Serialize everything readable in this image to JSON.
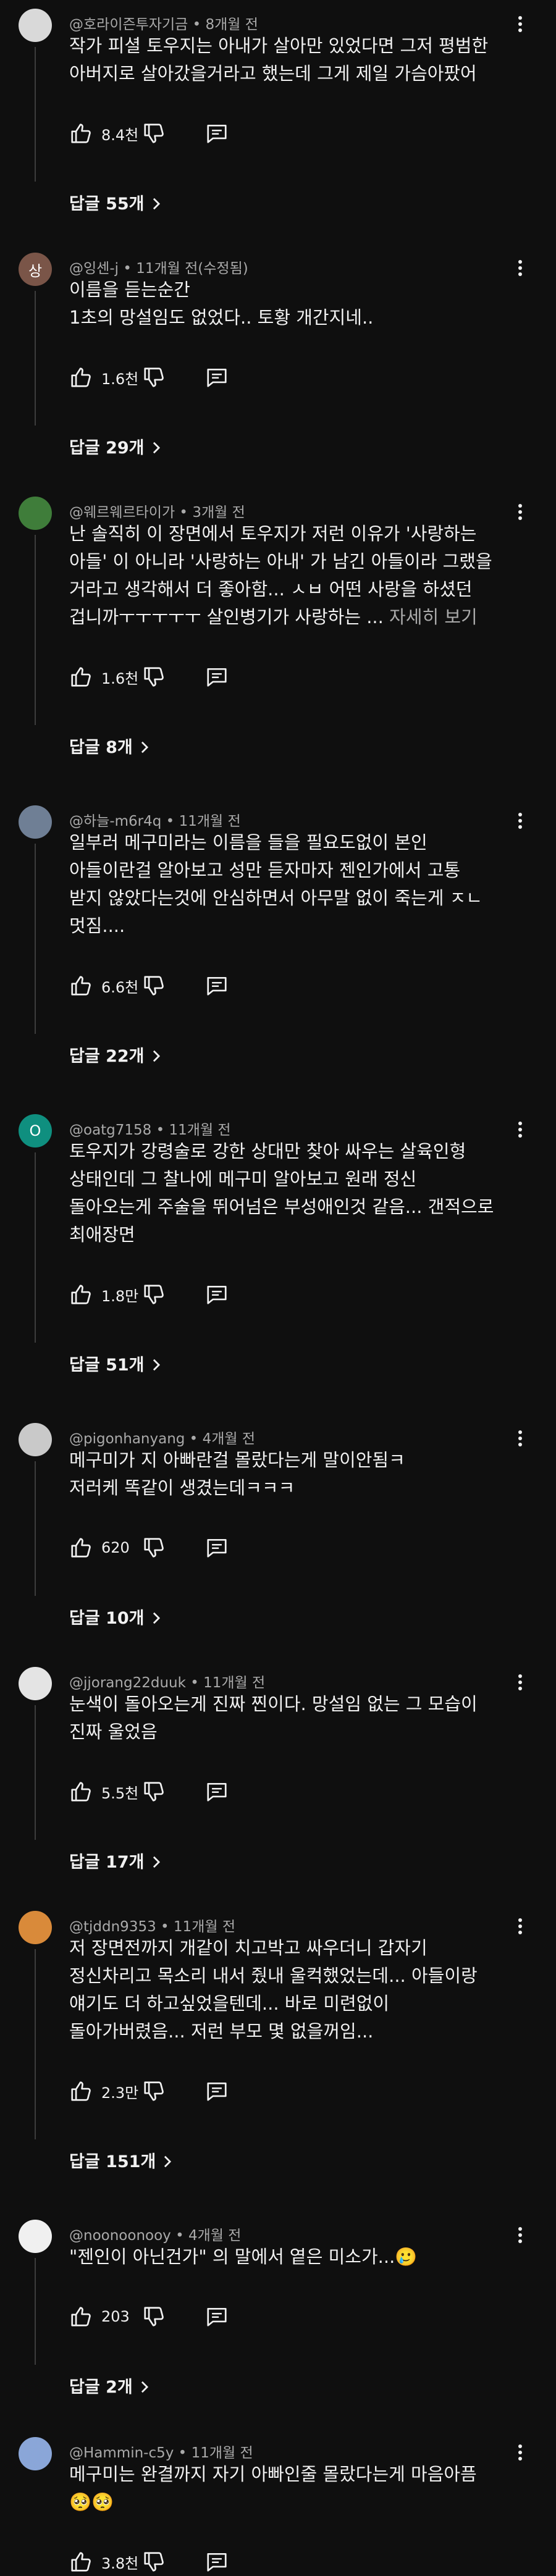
{
  "comments": [
    {
      "author": "@호라이즌투자기금",
      "time": "8개월 전",
      "lines": [
        "작가 피셜 토우지는 아내가 살아만 있었다면 그저 평범한",
        "아버지로 살아갔을거라고 했는데 그게 제일 가슴아팠어"
      ],
      "more": "",
      "likes": "8.4천",
      "replies": "답글 55개",
      "avatar_text": "",
      "avatar_color": "#d9d9d9"
    },
    {
      "author": "@잉센-j",
      "time": "11개월 전(수정됨)",
      "lines": [
        "이름을 듣는순간",
        "1초의 망설임도 없었다.. 토황 개간지네.."
      ],
      "more": "",
      "likes": "1.6천",
      "replies": "답글 29개",
      "avatar_text": "상",
      "avatar_color": "#7a5548"
    },
    {
      "author": "@웨르웨르타이가",
      "time": "3개월 전",
      "lines": [
        "난 솔직히 이 장면에서 토우지가 저런 이유가 '사랑하는",
        "아들' 이 아니라 '사랑하는 아내' 가 남긴 아들이라 그랬을",
        "거라고 생각해서 더 좋아함... ㅅㅂ 어떤 사랑을 하셨던",
        "겁니까ㅜㅜㅜㅜㅜ 살인병기가 사랑하는 ..."
      ],
      "more": "자세히 보기",
      "likes": "1.6천",
      "replies": "답글 8개",
      "avatar_text": "",
      "avatar_color": "#3f7d3a"
    },
    {
      "author": "@하늘-m6r4q",
      "time": "11개월 전",
      "lines": [
        "일부러 메구미라는 이름을 들을 필요도없이 본인",
        "아들이란걸 알아보고 성만 듣자마자 젠인가에서 고통",
        "받지 않았다는것에 안심하면서 아무말 없이 죽는게 ㅈㄴ",
        "멋짐...."
      ],
      "more": "",
      "likes": "6.6천",
      "replies": "답글 22개",
      "avatar_text": "",
      "avatar_color": "#6f7f95"
    },
    {
      "author": "@oatg7158",
      "time": "11개월 전",
      "lines": [
        "토우지가 강령술로 강한 상대만 찾아 싸우는 살육인형",
        "상태인데 그 찰나에 메구미 알아보고 원래 정신",
        "돌아오는게 주술을 뛰어넘은 부성애인것 같음... 갠적으로",
        "최애장면"
      ],
      "more": "",
      "likes": "1.8만",
      "replies": "답글 51개",
      "avatar_text": "O",
      "avatar_color": "#0f8f7f"
    },
    {
      "author": "@pigonhanyang",
      "time": "4개월 전",
      "lines": [
        "메구미가 지 아빠란걸 몰랐다는게 말이안됨ㅋ",
        "저러케 똑같이 생겼는데ㅋㅋㅋ"
      ],
      "more": "",
      "likes": "620",
      "replies": "답글 10개",
      "avatar_text": "",
      "avatar_color": "#c9c9c9"
    },
    {
      "author": "@jjorang22duuk",
      "time": "11개월 전",
      "lines": [
        "눈색이 돌아오는게 진짜 찐이다. 망설임 없는 그 모습이",
        "진짜 울었음"
      ],
      "more": "",
      "likes": "5.5천",
      "replies": "답글 17개",
      "avatar_text": "",
      "avatar_color": "#e4e4e4"
    },
    {
      "author": "@tjddn9353",
      "time": "11개월 전",
      "lines": [
        "저 장면전까지 개같이 치고박고 싸우더니 갑자기",
        "정신차리고 목소리 내서 줬내 울컥했었는데... 아들이랑",
        "얘기도 더 하고싶었을텐데... 바로 미련없이",
        "돌아가버렸음... 저런 부모 몇 없을꺼임..."
      ],
      "more": "",
      "likes": "2.3만",
      "replies": "답글 151개",
      "avatar_text": "",
      "avatar_color": "#d98a3a"
    },
    {
      "author": "@noonoonooy",
      "time": "4개월 전",
      "lines": [
        "\"젠인이 아닌건가\" 의 말에서 옅은 미소가...🥲"
      ],
      "more": "",
      "likes": "203",
      "replies": "답글 2개",
      "avatar_text": "",
      "avatar_color": "#f0f0f0"
    },
    {
      "author": "@Hammin-c5y",
      "time": "11개월 전",
      "lines": [
        "메구미는 완결까지 자기 아빠인줄 몰랐다는게 마음아픔",
        "🥺🥺"
      ],
      "more": "",
      "likes": "3.8천",
      "replies": "",
      "avatar_text": "",
      "avatar_color": "#8aa6d8"
    }
  ],
  "icons": {
    "like": "thumbs-up-icon",
    "dislike": "thumbs-down-icon",
    "reply": "comment-reply-icon",
    "menu": "kebab-menu-icon",
    "chevron": "chevron-right-icon"
  },
  "colors": {
    "background": "#0f0f0f",
    "text": "#f1f1f1",
    "meta": "#aaaaaa"
  }
}
